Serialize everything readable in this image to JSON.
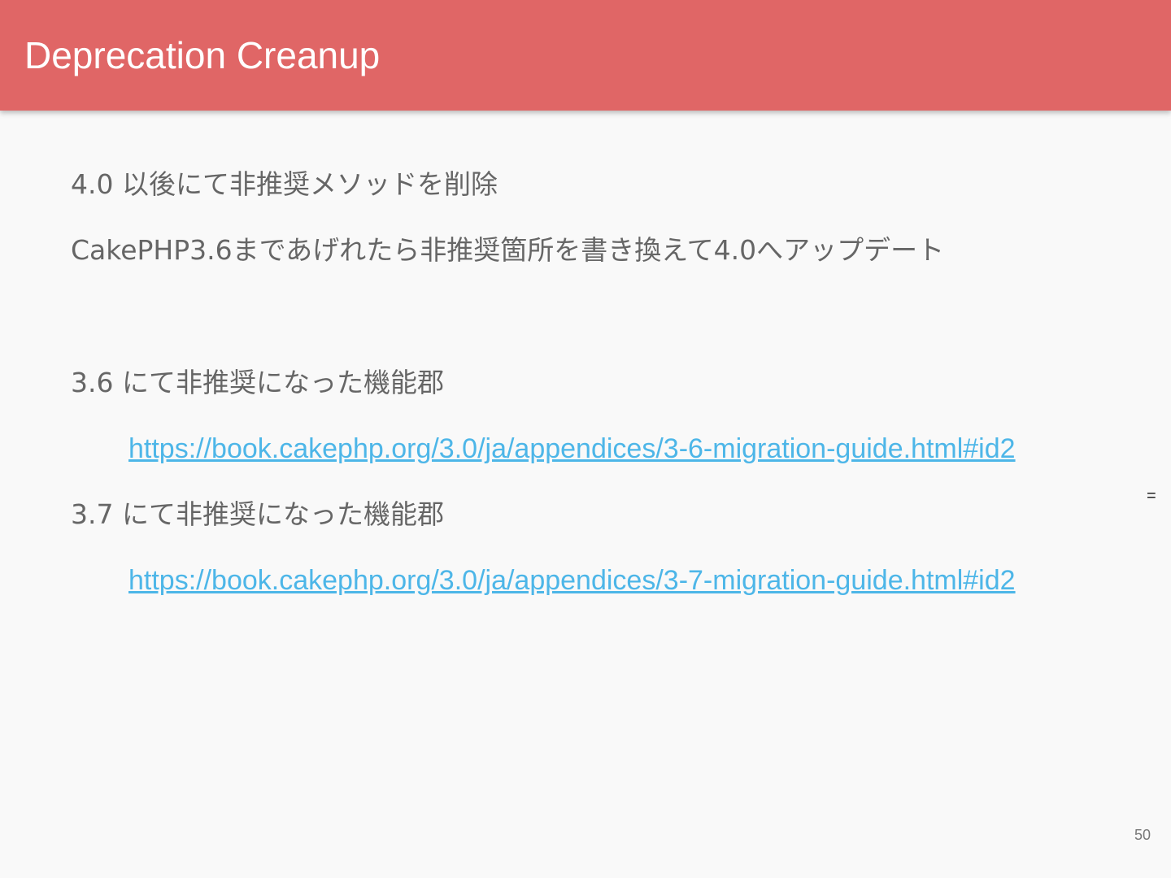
{
  "slide": {
    "title": "Deprecation Creanup",
    "page_number": "50",
    "side_mark": "="
  },
  "content": {
    "line1": "4.0 以後にて非推奨メソッドを削除",
    "line2": "CakePHP3.6まであげれたら非推奨箇所を書き換えて4.0へアップデート",
    "section36": {
      "heading": "3.6 にて非推奨になった機能郡",
      "link": "https://book.cakephp.org/3.0/ja/appendices/3-6-migration-guide.html#id2"
    },
    "section37": {
      "heading": "3.7 にて非推奨になった機能郡",
      "link": "https://book.cakephp.org/3.0/ja/appendices/3-7-migration-guide.html#id2"
    }
  },
  "colors": {
    "header_bg": "#e06666",
    "body_text": "#666666",
    "link": "#4db6e8",
    "background": "#f9f9f9"
  }
}
